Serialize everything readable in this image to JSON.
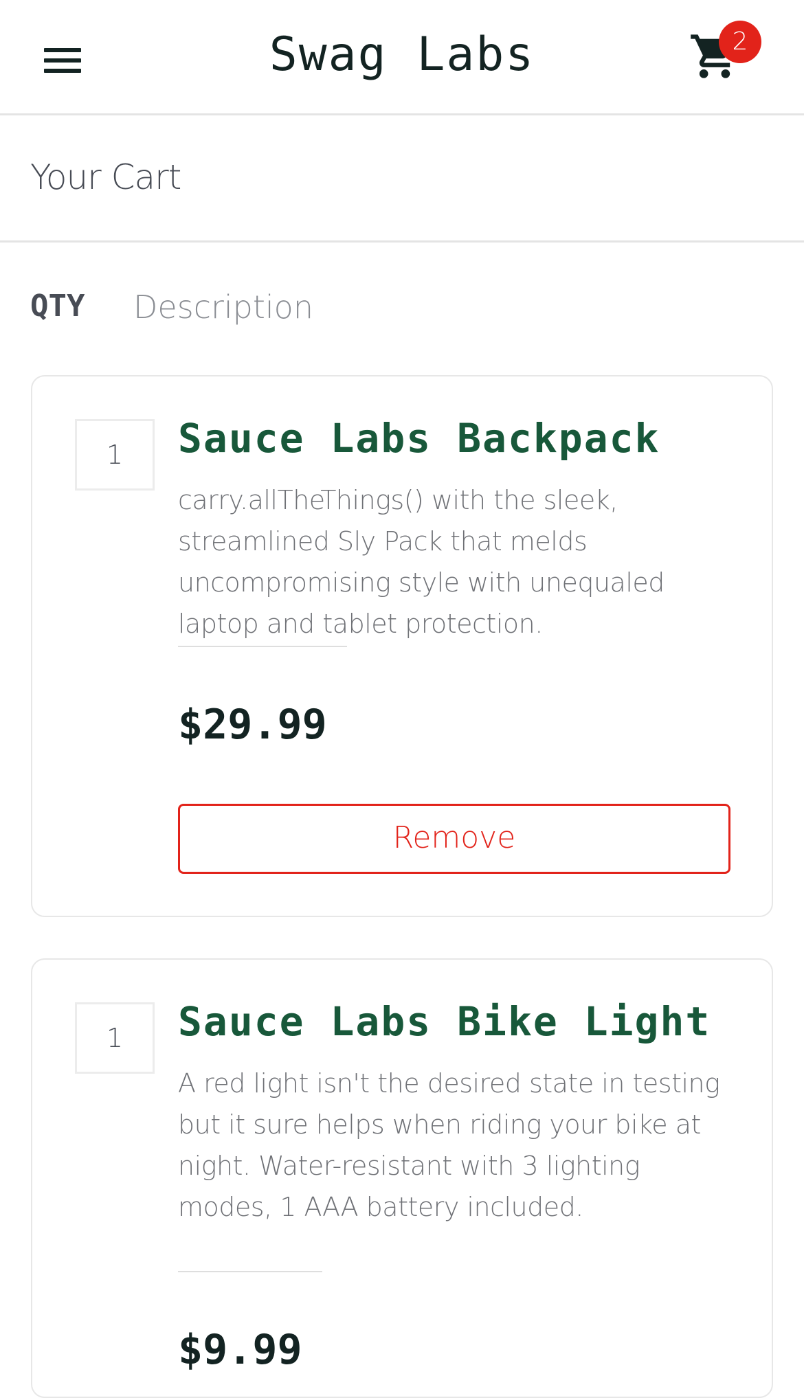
{
  "header": {
    "menu_icon": "hamburger-menu-icon",
    "title": "Swag Labs",
    "cart_icon": "shopping-cart-icon",
    "cart_count": "2",
    "badge_color": "#e2231a"
  },
  "page": {
    "title": "Your Cart"
  },
  "columns": {
    "qty": "QTY",
    "description": "Description"
  },
  "items": [
    {
      "quantity": "1",
      "name": "Sauce Labs Backpack",
      "description": "carry.allTheThings() with the sleek, streamlined Sly Pack that melds uncompromising style with unequaled laptop and tablet protection.",
      "price": "$29.99",
      "remove_label": "Remove"
    },
    {
      "quantity": "1",
      "name": "Sauce Labs Bike Light",
      "description": "A red light isn't the desired state in testing but it sure helps when riding your bike at night. Water-resistant with 3 lighting modes, 1 AAA battery included.",
      "price": "$9.99"
    }
  ],
  "colors": {
    "accent_green": "#18583a",
    "remove_red": "#e2231a",
    "text_dark": "#132322"
  }
}
